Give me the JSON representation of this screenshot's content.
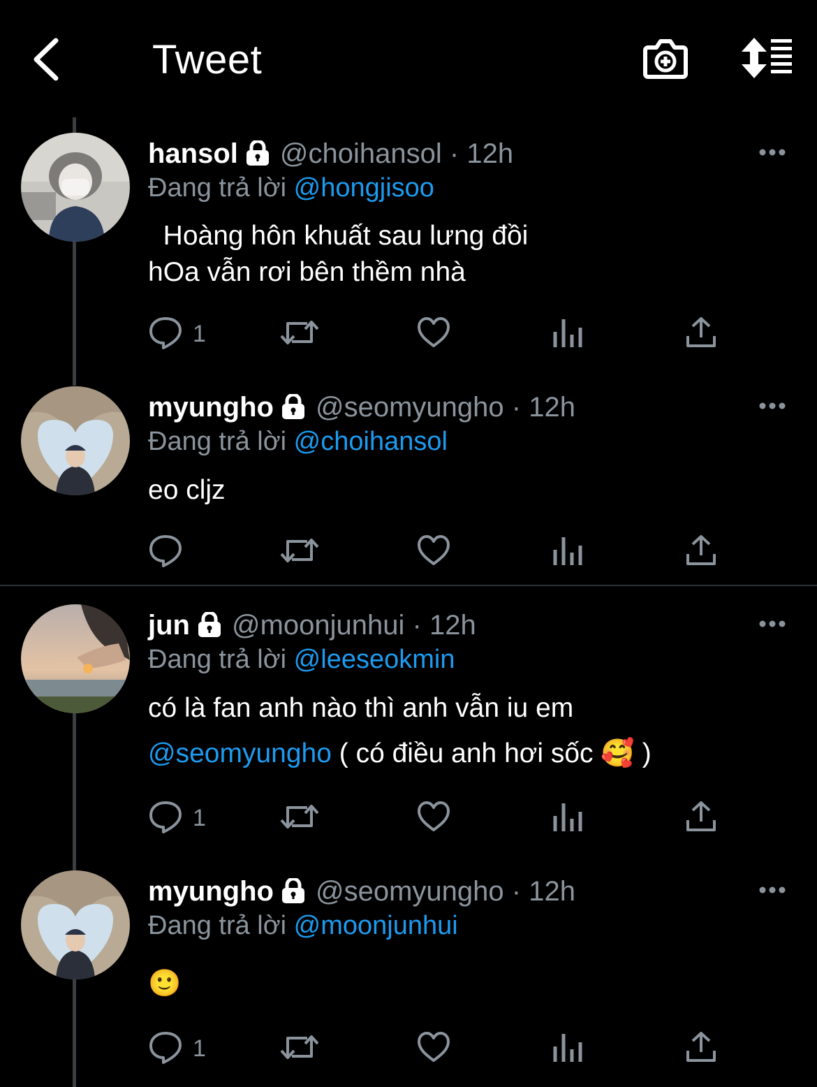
{
  "header": {
    "title": "Tweet"
  },
  "reply_prefix": "Đang trả lời",
  "tweets": [
    {
      "name": "hansol",
      "handle": "@choihansol",
      "time": "· 12h",
      "reply_to": "@hongjisoo",
      "text_line1": "  Hoàng hôn khuất sau lưng đồi",
      "text_line2": "hOa vẫn rơi bên thềm nhà",
      "reply_count": "1"
    },
    {
      "name": "myungho",
      "handle": "@seomyungho",
      "time": "· 12h",
      "reply_to": "@choihansol",
      "text_line1": "eo cljz",
      "reply_count": ""
    },
    {
      "name": "jun",
      "handle": "@moonjunhui",
      "time": "· 12h",
      "reply_to": "@leeseokmin",
      "text_line1": "có là fan anh nào thì anh vẫn iu em",
      "text_line2_mention": "@seomyungho",
      "text_line2_rest": " ( có điều anh hơi sốc ",
      "text_line2_emoji": "🥰",
      "text_line2_end": " )",
      "reply_count": "1"
    },
    {
      "name": "myungho",
      "handle": "@seomyungho",
      "time": "· 12h",
      "reply_to": "@moonjunhui",
      "emoji": "🙂",
      "reply_count": "1"
    }
  ],
  "colors": {
    "background": "#000000",
    "link": "#1d9bf0",
    "secondary": "#8b949d",
    "thread_line": "#3b3f44"
  },
  "icons": [
    "back-icon",
    "camera-add-icon",
    "sort-icon",
    "lock-icon",
    "more-icon",
    "reply-icon",
    "retweet-icon",
    "like-icon",
    "analytics-icon",
    "share-icon"
  ]
}
